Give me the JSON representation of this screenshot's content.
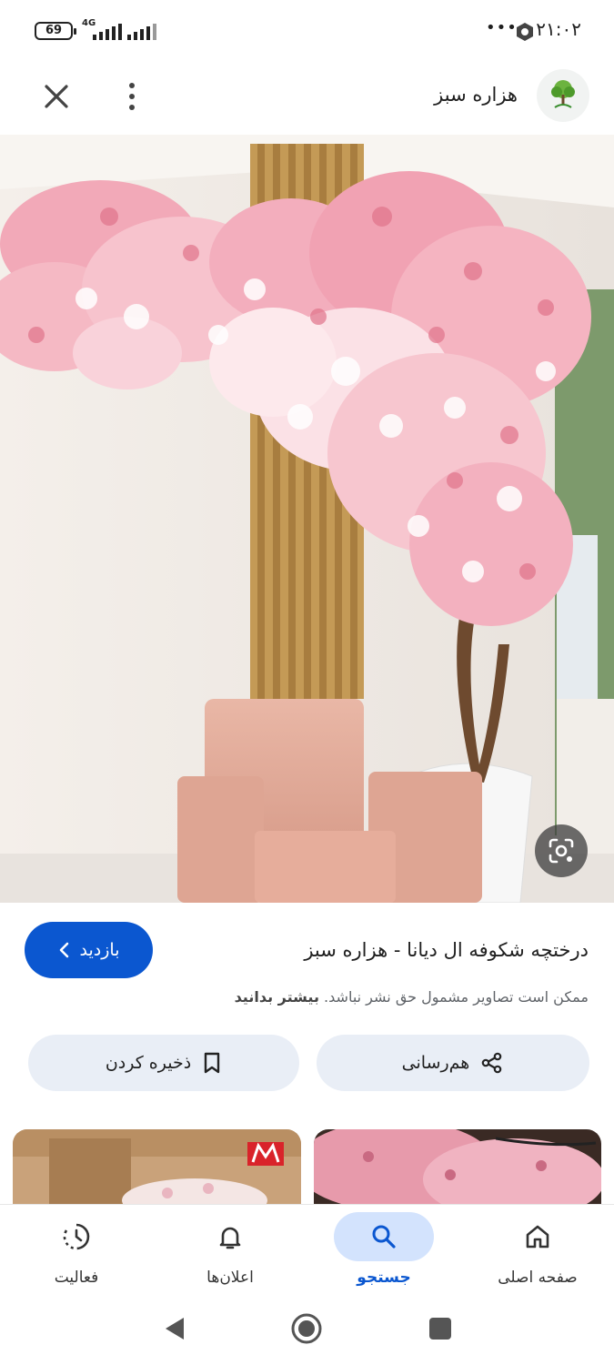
{
  "status_bar": {
    "battery": "69",
    "network": "4G",
    "time": "۲۱:۰۲",
    "more": "•••"
  },
  "header": {
    "site_name": "هزاره سبز",
    "close_icon": "close-icon",
    "menu_icon": "more-vert-icon"
  },
  "result": {
    "title": "درختچه شکوفه ال دیانا - هزاره سبز",
    "copyright_text": "ممکن است تصاویر مشمول حق نشر نباشد.",
    "learn_more": "بیشتر بدانید",
    "visit_label": "بازدید"
  },
  "actions": {
    "share_label": "هم‌رسانی",
    "save_label": "ذخیره کردن"
  },
  "bottom_nav": {
    "home": "صفحه اصلی",
    "search": "جستجو",
    "notifications": "اعلان‌ها",
    "activity": "فعالیت"
  },
  "colors": {
    "accent": "#0b57d0",
    "pill_bg": "#e9eef6",
    "nav_active_bg": "#d3e3fd"
  }
}
